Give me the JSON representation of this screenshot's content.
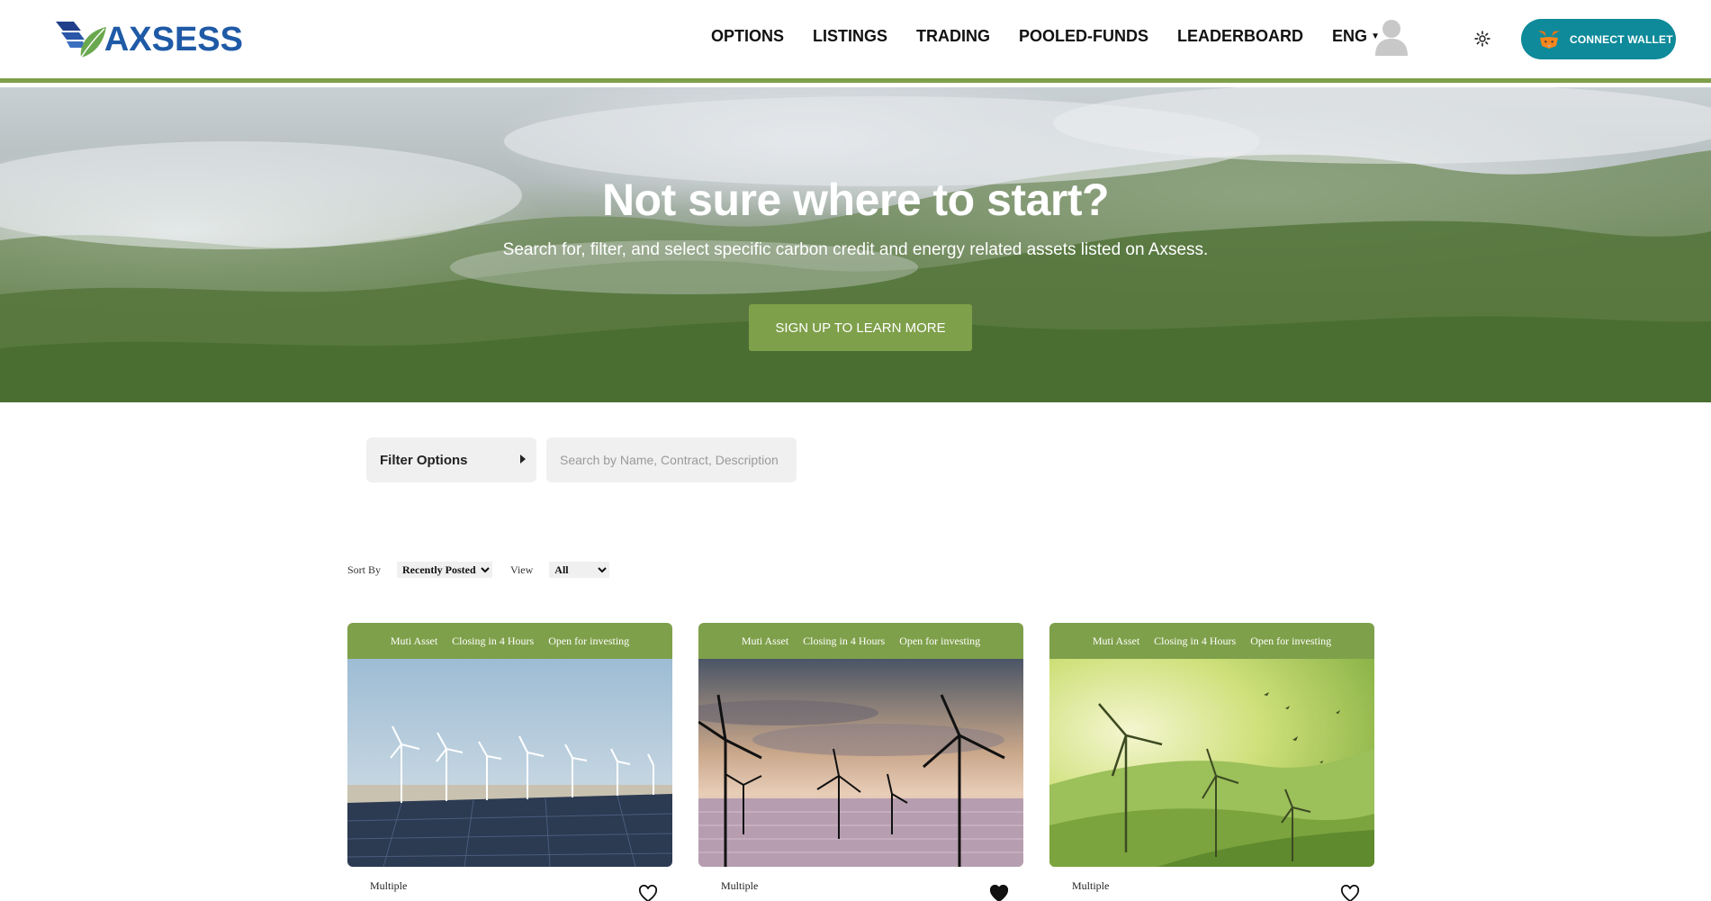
{
  "header": {
    "logo_text": "AXSESS",
    "nav": [
      "OPTIONS",
      "LISTINGS",
      "TRADING",
      "POOLED-FUNDS",
      "LEADERBOARD"
    ],
    "language": "ENG",
    "connect_wallet": "CONNECT WALLET"
  },
  "hero": {
    "title": "Not sure where to start?",
    "subtitle": "Search for, filter, and select specific carbon credit and energy related assets listed on Axsess.",
    "cta": "SIGN UP TO LEARN MORE"
  },
  "filter": {
    "label": "Filter Options",
    "search_placeholder": "Search by Name, Contract, Description"
  },
  "sort": {
    "sort_label": "Sort By",
    "sort_value": "Recently Posted",
    "view_label": "View",
    "view_value": "All"
  },
  "cards": [
    {
      "tags": [
        "Muti Asset",
        "Closing in 4 Hours",
        "Open for investing"
      ],
      "type": "Multiple",
      "favorited": false,
      "image": "wind-turbines-solar-panels"
    },
    {
      "tags": [
        "Muti Asset",
        "Closing in 4 Hours",
        "Open for investing"
      ],
      "type": "Multiple",
      "favorited": true,
      "image": "offshore-wind-turbines-sunset"
    },
    {
      "tags": [
        "Muti Asset",
        "Closing in 4 Hours",
        "Open for investing"
      ],
      "type": "Multiple",
      "favorited": false,
      "image": "wind-turbines-green-hills"
    }
  ],
  "colors": {
    "accent_green": "#7ea04a",
    "wallet_teal": "#0e8a9a",
    "logo_blue": "#1f5aa6"
  }
}
